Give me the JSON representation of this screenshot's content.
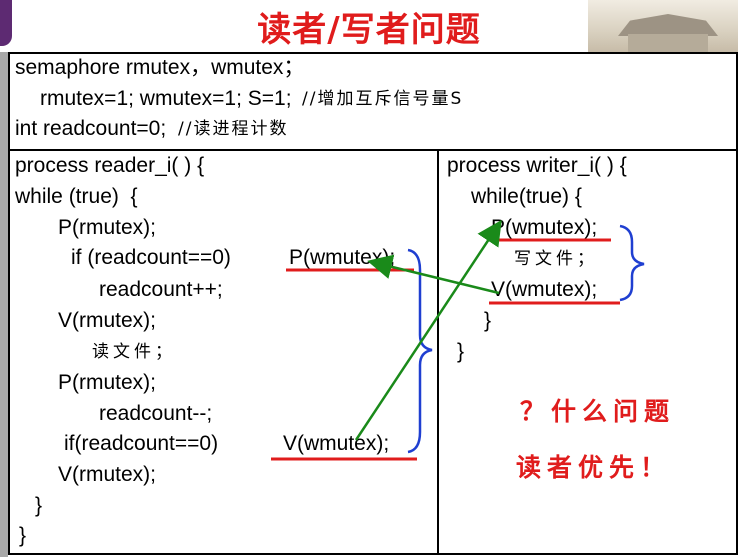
{
  "title": "读者/写者问题",
  "header": {
    "line1": "semaphore rmutex，wmutex；",
    "line2_code": "rmutex=1; wmutex=1; S=1; ",
    "line2_comment": "//增加互斥信号量S",
    "line3_code": "int readcount=0; ",
    "line3_comment": "//读进程计数"
  },
  "reader": {
    "l1": "process reader_i( ) {",
    "l2": "while (true)  {",
    "l3": "P(rmutex);",
    "l4_a": "if (readcount==0) ",
    "l4_b": "P(wmutex);",
    "l5": "readcount++;",
    "l6": "V(rmutex);",
    "l7": "读文件；",
    "l8": "P(rmutex);",
    "l9": "readcount--;",
    "l10_a": "if(readcount==0)  ",
    "l10_b": "V(wmutex);",
    "l11": "V(rmutex);",
    "l12": "}",
    "l13": "}"
  },
  "writer": {
    "l1": "process writer_i( ) {",
    "l2": "while(true) {",
    "l3": "P(wmutex);",
    "l4": "写文件；",
    "l5": "V(wmutex);",
    "l6": "}",
    "l7": "}"
  },
  "notes": {
    "q": "？什么问题",
    "a": "读者优先！"
  },
  "colors": {
    "red": "#e01c1c",
    "green": "#1a8a1a",
    "blue": "#1f3fd1"
  }
}
